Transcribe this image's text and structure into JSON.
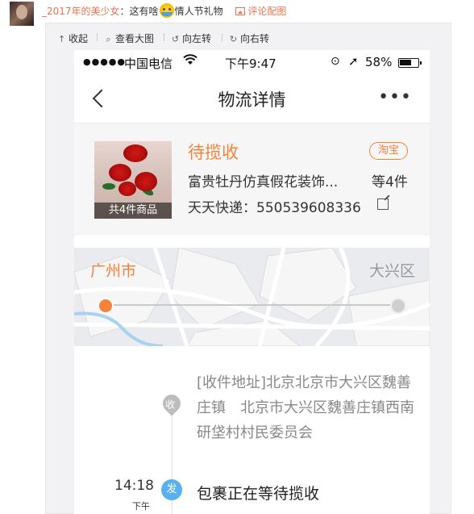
{
  "comment": {
    "username": "_2017年的美少女",
    "text": "：这有啥",
    "gift": "情人节礼物",
    "pic_comment": "评论配图"
  },
  "viewer_toolbar": {
    "collapse": "收起",
    "view_large": "查看大图",
    "rotate_left": "向左转",
    "rotate_right": "向右转"
  },
  "status_bar": {
    "signal": "●●●●●",
    "carrier": "中国电信",
    "time": "下午9:47",
    "battery": "58%"
  },
  "nav": {
    "title": "物流详情",
    "more": "•••"
  },
  "product": {
    "status": "待揽收",
    "source_badge": "淘宝",
    "name": "富贵牡丹仿真假花装饰...",
    "count": "等4件",
    "courier": "天天快递：550539608336",
    "thumb_label": "共4件商品"
  },
  "map": {
    "from_city": "广州市",
    "to_city": "大兴区"
  },
  "timeline": {
    "address_badge": "收",
    "address": "[收件地址]北京北京市大兴区魏善庄镇　北京市大兴区魏善庄镇西南研垡村村民委员会",
    "events": [
      {
        "time": "14:18",
        "period": "下午",
        "badge": "发",
        "text": "包裹正在等待揽收"
      }
    ]
  },
  "colors": {
    "accent_orange": "#f5813a",
    "weibo_orange": "#eb7350",
    "event_blue": "#57b0ef"
  }
}
